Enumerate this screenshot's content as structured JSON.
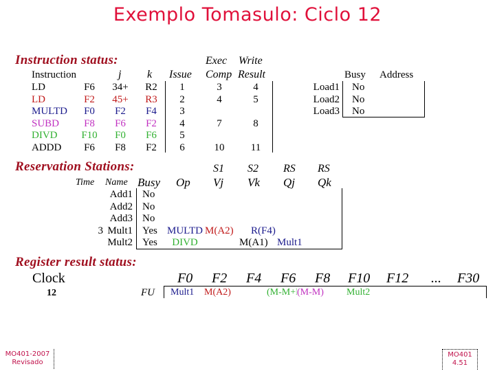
{
  "title": "Exemplo Tomasulo: Ciclo 12",
  "colors": {
    "title": "#e0103a",
    "section": "#a01020",
    "black": "#000000",
    "red": "#c01818",
    "blue": "#1a1a8c",
    "magenta": "#c030c0",
    "green": "#30b030",
    "footer": "#c0104a"
  },
  "instruction_status": {
    "label": "Instruction status:",
    "headers": {
      "instruction": "Instruction",
      "j": "j",
      "k": "k",
      "issue": "Issue",
      "exec_top": "Exec",
      "exec_bottom": "Comp",
      "write_top": "Write",
      "write_bottom": "Result"
    },
    "rows": [
      {
        "op": "LD",
        "dest": "F6",
        "j": "34+",
        "k": "R2",
        "issue": "1",
        "exec": "3",
        "write": "4",
        "color": "black"
      },
      {
        "op": "LD",
        "dest": "F2",
        "j": "45+",
        "k": "R3",
        "issue": "2",
        "exec": "4",
        "write": "5",
        "color": "red"
      },
      {
        "op": "MULTD",
        "dest": "F0",
        "j": "F2",
        "k": "F4",
        "issue": "3",
        "exec": "",
        "write": "",
        "color": "blue"
      },
      {
        "op": "SUBD",
        "dest": "F8",
        "j": "F6",
        "k": "F2",
        "issue": "4",
        "exec": "7",
        "write": "8",
        "color": "magenta"
      },
      {
        "op": "DIVD",
        "dest": "F10",
        "j": "F0",
        "k": "F6",
        "issue": "5",
        "exec": "",
        "write": "",
        "color": "green"
      },
      {
        "op": "ADDD",
        "dest": "F6",
        "j": "F8",
        "k": "F2",
        "issue": "6",
        "exec": "10",
        "write": "11",
        "color": "black"
      }
    ]
  },
  "load_buffers": {
    "headers": {
      "busy": "Busy",
      "address": "Address"
    },
    "rows": [
      {
        "name": "Load1",
        "busy": "No",
        "address": ""
      },
      {
        "name": "Load2",
        "busy": "No",
        "address": ""
      },
      {
        "name": "Load3",
        "busy": "No",
        "address": ""
      }
    ]
  },
  "reservation_stations": {
    "label": "Reservation Stations:",
    "headers": {
      "time": "Time",
      "name": "Name",
      "busy": "Busy",
      "op": "Op",
      "s1_top": "S1",
      "s1_bottom": "Vj",
      "s2_top": "S2",
      "s2_bottom": "Vk",
      "rsj_top": "RS",
      "rsj_bottom": "Qj",
      "rsk_top": "RS",
      "rsk_bottom": "Qk"
    },
    "rows": [
      {
        "time": "",
        "name": "Add1",
        "busy": "No",
        "op": "",
        "vj": "",
        "vk": "",
        "qj": "",
        "qk": ""
      },
      {
        "time": "",
        "name": "Add2",
        "busy": "No",
        "op": "",
        "vj": "",
        "vk": "",
        "qj": "",
        "qk": ""
      },
      {
        "time": "",
        "name": "Add3",
        "busy": "No",
        "op": "",
        "vj": "",
        "vk": "",
        "qj": "",
        "qk": ""
      },
      {
        "time": "3",
        "name": "Mult1",
        "busy": "Yes",
        "op": "MULTD",
        "vj": "M(A2)",
        "vk": "R(F4)",
        "qj": "",
        "qk": ""
      },
      {
        "time": "",
        "name": "Mult2",
        "busy": "Yes",
        "op": "DIVD",
        "vj": "",
        "vk": "M(A1)",
        "qj": "Mult1",
        "qk": ""
      }
    ]
  },
  "register_status": {
    "label": "Register result status:",
    "clock_label": "Clock",
    "clock_value": "12",
    "fu_label": "FU",
    "registers": [
      "F0",
      "F2",
      "F4",
      "F6",
      "F8",
      "F10",
      "F12",
      "...",
      "F30"
    ],
    "values": [
      "Mult1",
      "M(A2)",
      "",
      "(M-M+M",
      "(M-M)",
      "Mult2",
      "",
      "",
      ""
    ]
  },
  "footer": {
    "left_line1": "MO401-2007",
    "left_line2": "Revisado",
    "right_line1": "MO401",
    "right_line2": "4.51"
  }
}
